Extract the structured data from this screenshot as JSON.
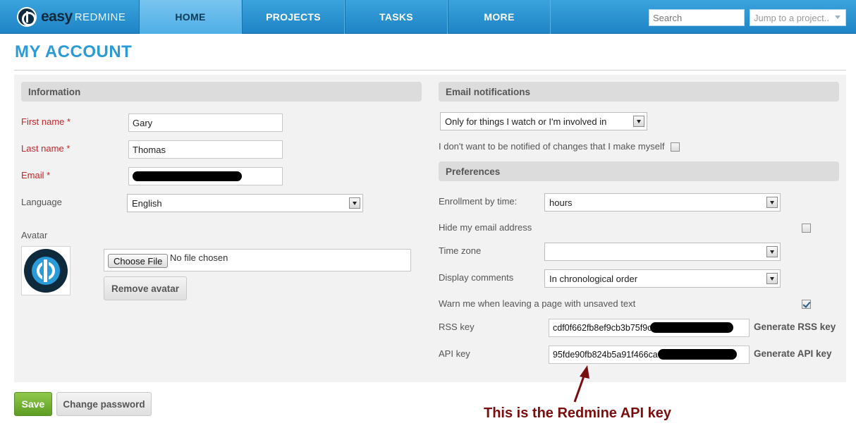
{
  "brand": {
    "name_bold": "easy",
    "name_light": "REDMINE"
  },
  "nav": {
    "items": [
      {
        "label": "HOME",
        "active": true
      },
      {
        "label": "PROJECTS",
        "active": false
      },
      {
        "label": "TASKS",
        "active": false
      },
      {
        "label": "MORE",
        "active": false
      }
    ]
  },
  "search": {
    "placeholder": "Search"
  },
  "jump": {
    "placeholder": "Jump to a project.."
  },
  "page": {
    "title": "MY ACCOUNT"
  },
  "information": {
    "heading": "Information",
    "first_name": {
      "label": "First name *",
      "value": "Gary"
    },
    "last_name": {
      "label": "Last name *",
      "value": "Thomas"
    },
    "email": {
      "label": "Email *",
      "value": ""
    },
    "language": {
      "label": "Language",
      "value": "English"
    },
    "avatar": {
      "label": "Avatar",
      "choose_file": "Choose File",
      "file_status": "No file chosen",
      "remove": "Remove avatar"
    }
  },
  "email_notifications": {
    "heading": "Email notifications",
    "mode": "Only for things I watch or I'm involved in",
    "no_self_notified": {
      "label": "I don't want to be notified of changes that I make myself",
      "checked": false
    }
  },
  "preferences": {
    "heading": "Preferences",
    "enrollment": {
      "label": "Enrollment by time:",
      "value": "hours"
    },
    "hide_mail": {
      "label": "Hide my email address",
      "checked": false
    },
    "time_zone": {
      "label": "Time zone",
      "value": ""
    },
    "comments": {
      "label": "Display comments",
      "value": "In chronological order"
    },
    "warn_unsaved": {
      "label": "Warn me when leaving a page with unsaved text",
      "checked": true
    },
    "rss_key": {
      "label": "RSS key",
      "value": "cdf0f662fb8ef9cb3b75f9c",
      "generate": "Generate RSS key"
    },
    "api_key": {
      "label": "API key",
      "value": "95fde90fb824b5a91f466ca",
      "generate": "Generate API key"
    }
  },
  "actions": {
    "save": "Save",
    "change_password": "Change password"
  },
  "annotation": {
    "text": "This is the Redmine API key",
    "color": "#7a0d0d"
  },
  "colors": {
    "header": "#2a95d4",
    "accent_title": "#2a9bd7",
    "required": "#c0272d",
    "save": "#6aa92e"
  }
}
